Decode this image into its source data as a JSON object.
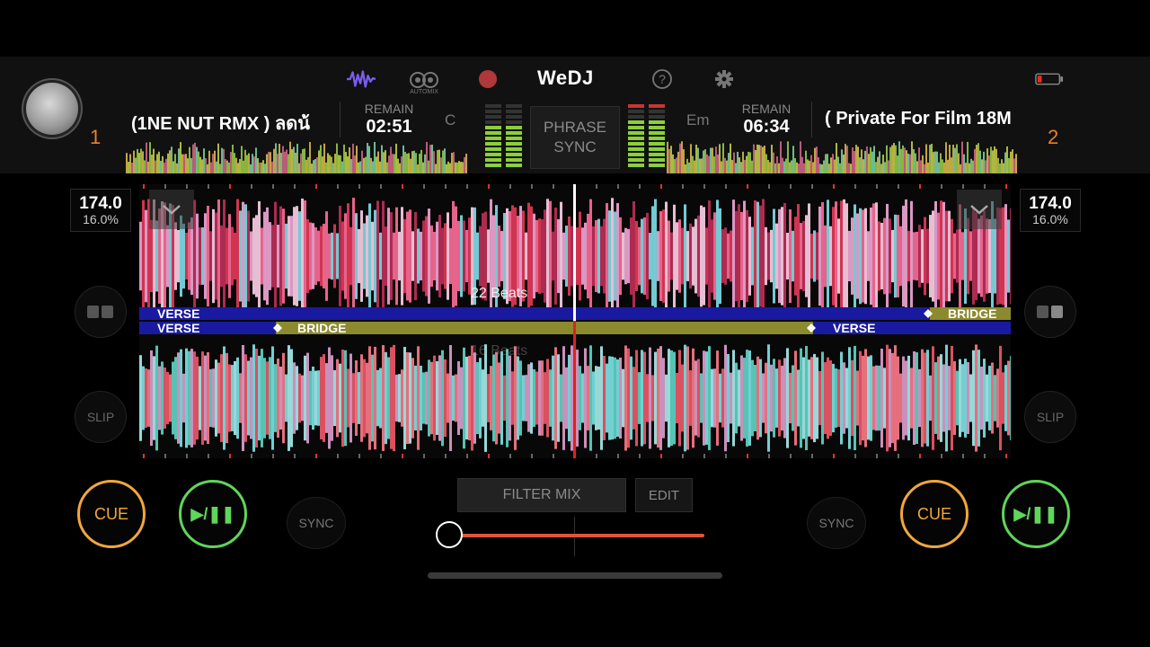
{
  "app": {
    "title": "WeDJ"
  },
  "topbar": {
    "icons": [
      "waveform-icon",
      "automix-icon",
      "record-icon",
      "help-icon",
      "gear-icon",
      "battery-icon"
    ],
    "automix_label": "AUTOMIX",
    "phrase_sync_line1": "PHRASE",
    "phrase_sync_line2": "SYNC"
  },
  "deck1": {
    "number": "1",
    "track_title": "(1NE NUT RMX ) ลดน้",
    "remain_label": "REMAIN",
    "remain_time": "02:51",
    "key": "C",
    "bpm": "174.0",
    "pitch": "16.0%",
    "beats_label": "22 Beats",
    "cue_label": "CUE",
    "play_label": "▶/❚❚",
    "sync_label": "SYNC",
    "slip_label": "SLIP"
  },
  "deck2": {
    "number": "2",
    "track_title": "( Private For Film 18M",
    "remain_label": "REMAIN",
    "remain_time": "06:34",
    "key": "Em",
    "bpm": "174.0",
    "pitch": "16.0%",
    "beats_label": "16 Beats",
    "cue_label": "CUE",
    "play_label": "▶/❚❚",
    "sync_label": "SYNC",
    "slip_label": "SLIP"
  },
  "phrases": {
    "verse": "VERSE",
    "bridge": "BRIDGE"
  },
  "mixer": {
    "filter_mix_label": "FILTER MIX",
    "edit_label": "EDIT",
    "crossfader_level": 0.0
  },
  "colors": {
    "accent_orange": "#e8802a",
    "cue": "#f0a73c",
    "play": "#5fd65a",
    "phrase_verse": "#1a1aa0",
    "phrase_bridge": "#8c8a2e",
    "crossfader": "#e0553a",
    "record": "#b0383a",
    "waveform_icon": "#7b5cf0"
  }
}
